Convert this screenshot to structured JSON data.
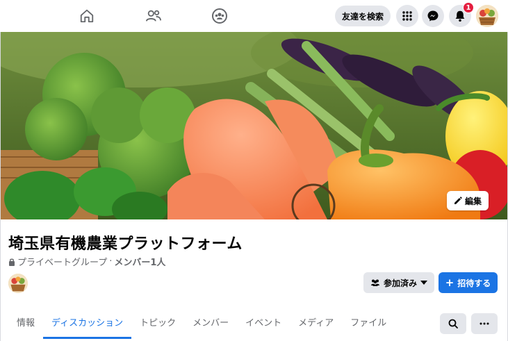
{
  "topbar": {
    "nav_icons": [
      "home-icon",
      "friends-icon",
      "groups-icon"
    ],
    "search_label": "友達を検索",
    "notification_count": "1",
    "right_icons": [
      "menu-grid-icon",
      "messenger-icon",
      "bell-icon"
    ]
  },
  "cover": {
    "edit_label": "編集"
  },
  "group": {
    "title": "埼玉県有機農業プラットフォーム",
    "privacy": "プライベートグループ",
    "separator": "·",
    "members": "メンバー1人"
  },
  "actions": {
    "joined_label": "参加済み",
    "invite_label": "招待する"
  },
  "tabs": [
    {
      "label": "情報",
      "active": false
    },
    {
      "label": "ディスカッション",
      "active": true
    },
    {
      "label": "トピック",
      "active": false
    },
    {
      "label": "メンバー",
      "active": false
    },
    {
      "label": "イベント",
      "active": false
    },
    {
      "label": "メディア",
      "active": false
    },
    {
      "label": "ファイル",
      "active": false
    }
  ],
  "colors": {
    "accent": "#1b74e4",
    "badge": "#e41e3f",
    "button_gray": "#e4e6eb",
    "secondary_text": "#65676b"
  }
}
